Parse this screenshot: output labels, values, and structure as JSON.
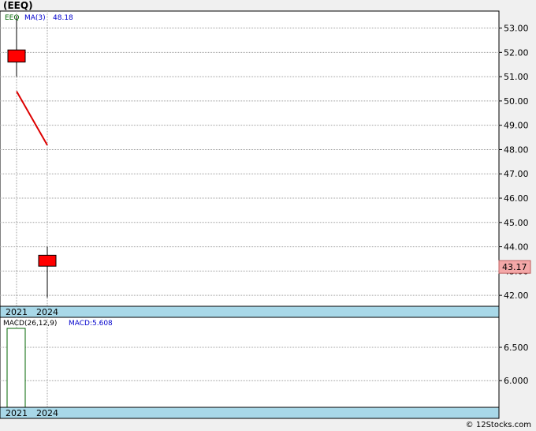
{
  "title": "(EEQ)",
  "copyright": "© 12Stocks.com",
  "chart_data": [
    {
      "type": "candlestick",
      "symbol_label": "EEQ",
      "ma_label": "MA(3)",
      "ma_value_label": "48.18",
      "last_price_label": "43.17",
      "x_tick_labels": [
        "2021",
        "2024"
      ],
      "y_ticks": [
        42,
        43,
        44,
        45,
        46,
        47,
        48,
        49,
        50,
        51,
        52,
        53
      ],
      "y_tick_labels": [
        "42.00",
        "43.00",
        "44.00",
        "45.00",
        "46.00",
        "47.00",
        "48.00",
        "49.00",
        "50.00",
        "51.00",
        "52.00",
        "53.00"
      ],
      "ylim": [
        41.55,
        53.7
      ],
      "grid": true,
      "candles": [
        {
          "x": "2021",
          "open": 51.6,
          "high": 53.5,
          "low": 51.0,
          "close": 52.1
        },
        {
          "x": "2024",
          "open": 43.2,
          "high": 44.0,
          "low": 41.9,
          "close": 43.65
        }
      ],
      "ma_line": [
        {
          "x": "2021",
          "y": 50.4
        },
        {
          "x": "2024",
          "y": 48.18
        }
      ],
      "last_price": 43.17,
      "colors": {
        "candle": "#ff0000",
        "ma": "#dd0000",
        "grid": "#a0a0a0",
        "axis_band": "#a8d8e8",
        "last_price_box": "#f4a8a8"
      }
    },
    {
      "type": "bar",
      "indicator_label": "MACD(26,12,9)",
      "macd_value_label": "MACD:5.608",
      "x_tick_labels": [
        "2021",
        "2024"
      ],
      "y_ticks": [
        6.0,
        6.5
      ],
      "y_tick_labels": [
        "6.000",
        "6.500"
      ],
      "ylim": [
        5.6,
        6.95
      ],
      "grid": true,
      "bars": [
        {
          "x": "2021",
          "value": 6.95
        }
      ],
      "colors": {
        "bar_edge": "#006600"
      }
    }
  ]
}
